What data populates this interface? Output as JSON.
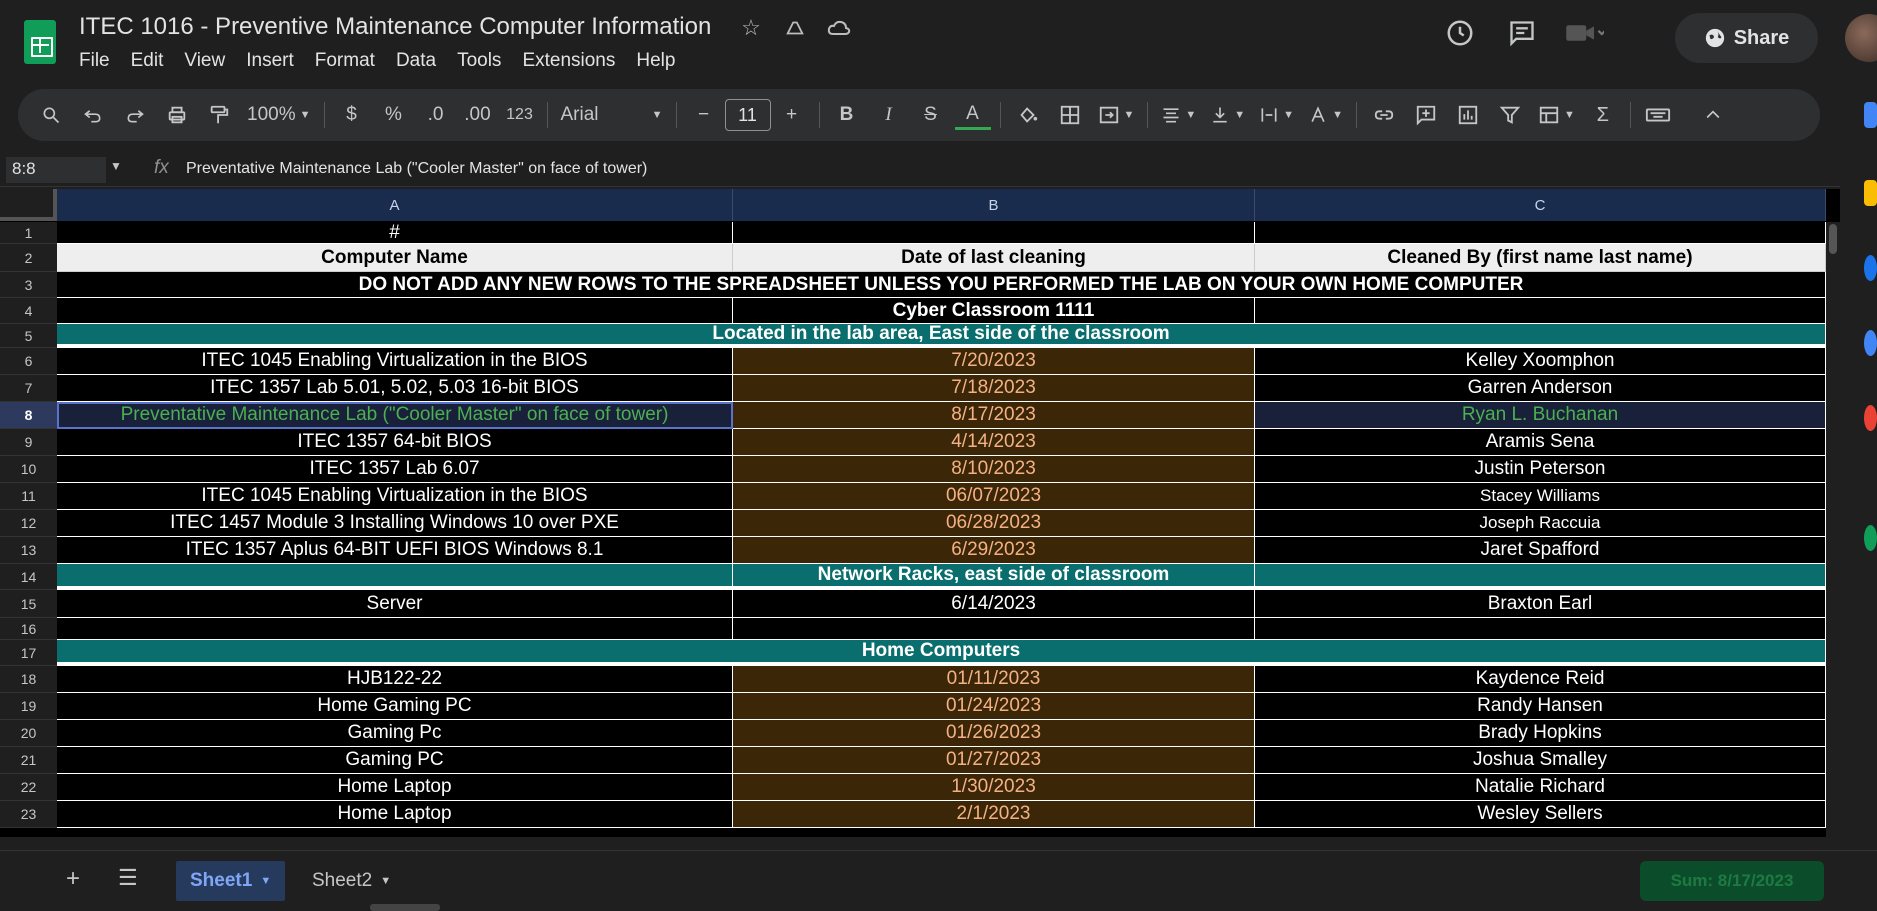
{
  "app": {
    "doc_title": "ITEC 1016 - Preventive Maintenance Computer Information",
    "menu": [
      "File",
      "Edit",
      "View",
      "Insert",
      "Format",
      "Data",
      "Tools",
      "Extensions",
      "Help"
    ],
    "share_label": "Share"
  },
  "toolbar": {
    "zoom": "100%",
    "currency": "$",
    "percent": "%",
    "dec_decrease": ".0",
    "dec_increase": ".00",
    "number_format": "123",
    "font_family": "Arial",
    "font_size": "11",
    "minus": "−",
    "plus": "+",
    "bold": "B",
    "italic": "I",
    "strike": "S",
    "text_color": "A",
    "sigma": "Σ"
  },
  "formula_bar": {
    "cell_ref": "8:8",
    "fx": "fx",
    "content": "Preventative Maintenance Lab (\"Cooler Master\" on face of tower)"
  },
  "columns": [
    "A",
    "B",
    "C"
  ],
  "rows": [
    {
      "num": "1",
      "type": "plain",
      "a": "#",
      "b": "",
      "c": ""
    },
    {
      "num": "2",
      "type": "header",
      "a": "Computer Name",
      "b": "Date of last cleaning",
      "c": "Cleaned By (first name last name)"
    },
    {
      "num": "3",
      "type": "merged-bold",
      "text": "DO NOT ADD ANY NEW ROWS TO THE SPREADSHEET UNLESS YOU PERFORMED THE LAB ON YOUR OWN HOME COMPUTER"
    },
    {
      "num": "4",
      "type": "plain-bold",
      "a": "",
      "b": "Cyber Classroom 1111",
      "c": ""
    },
    {
      "num": "5",
      "type": "teal",
      "text": "Located in the lab area, East side of the classroom"
    },
    {
      "num": "6",
      "type": "data",
      "a": "ITEC 1045 Enabling Virtualization in the BIOS",
      "b": "7/20/2023",
      "c": "Kelley Xoomphon"
    },
    {
      "num": "7",
      "type": "data",
      "a": "ITEC 1357 Lab 5.01, 5.02, 5.03 16-bit BIOS",
      "b": "7/18/2023",
      "c": "Garren Anderson"
    },
    {
      "num": "8",
      "type": "selected",
      "a": "Preventative Maintenance Lab (\"Cooler Master\" on face of tower)",
      "b": "8/17/2023",
      "c": "Ryan L. Buchanan"
    },
    {
      "num": "9",
      "type": "data",
      "a": "ITEC 1357 64-bit BIOS",
      "b": "4/14/2023",
      "c": "Aramis Sena"
    },
    {
      "num": "10",
      "type": "data",
      "a": "ITEC 1357 Lab 6.07",
      "b": "8/10/2023",
      "c": "Justin Peterson"
    },
    {
      "num": "11",
      "type": "data",
      "a": "ITEC 1045 Enabling Virtualization in the BIOS",
      "b": "06/07/2023",
      "c": "Stacey Williams",
      "small_c": true
    },
    {
      "num": "12",
      "type": "data",
      "a": "ITEC 1457 Module 3 Installing Windows 10 over PXE",
      "b": "06/28/2023",
      "c": "Joseph Raccuia",
      "small_c": true
    },
    {
      "num": "13",
      "type": "data",
      "a": "ITEC 1357 Aplus 64-BIT UEFI BIOS Windows 8.1",
      "b": "6/29/2023",
      "c": "Jaret Spafford"
    },
    {
      "num": "14",
      "type": "teal3",
      "a": "",
      "b": "Network Racks, east side of classroom",
      "c": ""
    },
    {
      "num": "15",
      "type": "plain",
      "a": "Server",
      "b": "6/14/2023",
      "c": "Braxton Earl"
    },
    {
      "num": "16",
      "type": "plain",
      "a": "",
      "b": "",
      "c": ""
    },
    {
      "num": "17",
      "type": "teal",
      "text": "Home Computers"
    },
    {
      "num": "18",
      "type": "data",
      "a": "HJB122-22",
      "b": "01/11/2023",
      "c": "Kaydence Reid"
    },
    {
      "num": "19",
      "type": "data",
      "a": "Home Gaming PC",
      "b": "01/24/2023",
      "c": "Randy Hansen"
    },
    {
      "num": "20",
      "type": "data",
      "a": "Gaming Pc",
      "b": "01/26/2023",
      "c": "Brady Hopkins"
    },
    {
      "num": "21",
      "type": "data",
      "a": "Gaming PC",
      "b": "01/27/2023",
      "c": "Joshua Smalley"
    },
    {
      "num": "22",
      "type": "data",
      "a": "Home Laptop",
      "b": "1/30/2023",
      "c": "Natalie Richard"
    },
    {
      "num": "23",
      "type": "data",
      "a": "Home Laptop",
      "b": "2/1/2023",
      "c": "Wesley Sellers"
    }
  ],
  "sheets": [
    {
      "label": "Sheet1",
      "active": true
    },
    {
      "label": "Sheet2",
      "active": false
    }
  ],
  "sum_badge": "Sum: 8/17/2023",
  "colors": {
    "teal": "#0b6e6e",
    "date_bg": "#3b2708",
    "date_text": "#f4b183",
    "selected_text": "#4caf50",
    "header_bg": "#1a2c4e"
  }
}
